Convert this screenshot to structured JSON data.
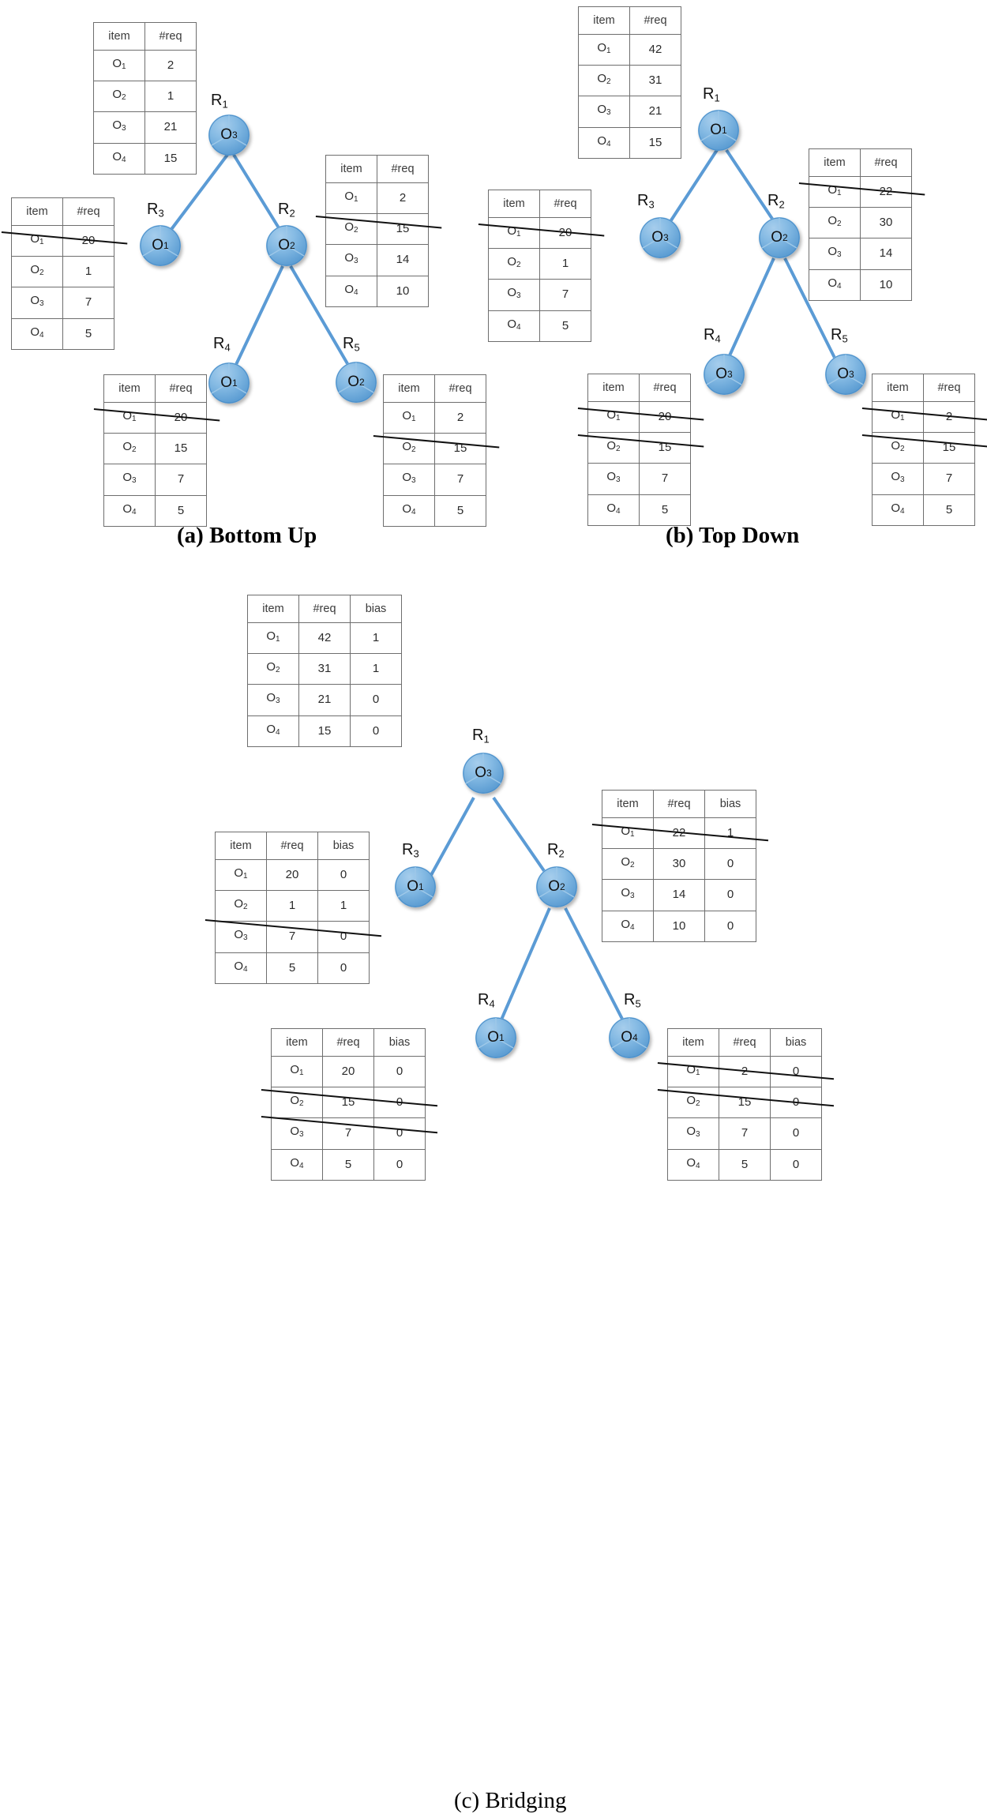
{
  "figure": {
    "panels": [
      {
        "id": "a",
        "caption": "(a) Bottom Up",
        "columns": [
          "item",
          "#req"
        ],
        "nodes": [
          {
            "name": "R1",
            "label": "R",
            "sub": "1",
            "item": "O",
            "item_sub": "3"
          },
          {
            "name": "R3",
            "label": "R",
            "sub": "3",
            "item": "O",
            "item_sub": "1"
          },
          {
            "name": "R2",
            "label": "R",
            "sub": "2",
            "item": "O",
            "item_sub": "2"
          },
          {
            "name": "R4",
            "label": "R",
            "sub": "4",
            "item": "O",
            "item_sub": "1"
          },
          {
            "name": "R5",
            "label": "R",
            "sub": "5",
            "item": "O",
            "item_sub": "2"
          }
        ],
        "tables": [
          {
            "for": "R1",
            "header": [
              "item",
              "#req"
            ],
            "rows": [
              [
                "O1",
                "2"
              ],
              [
                "O2",
                "1"
              ],
              [
                "O3",
                "21"
              ],
              [
                "O4",
                "15"
              ]
            ],
            "struck": []
          },
          {
            "for": "R3",
            "header": [
              "item",
              "#req"
            ],
            "rows": [
              [
                "O1",
                "20"
              ],
              [
                "O2",
                "1"
              ],
              [
                "O3",
                "7"
              ],
              [
                "O4",
                "5"
              ]
            ],
            "struck": [
              0
            ]
          },
          {
            "for": "R2",
            "header": [
              "item",
              "#req"
            ],
            "rows": [
              [
                "O1",
                "2"
              ],
              [
                "O2",
                "15"
              ],
              [
                "O3",
                "14"
              ],
              [
                "O4",
                "10"
              ]
            ],
            "struck": [
              1
            ]
          },
          {
            "for": "R4",
            "header": [
              "item",
              "#req"
            ],
            "rows": [
              [
                "O1",
                "20"
              ],
              [
                "O2",
                "15"
              ],
              [
                "O3",
                "7"
              ],
              [
                "O4",
                "5"
              ]
            ],
            "struck": [
              0
            ]
          },
          {
            "for": "R5",
            "header": [
              "item",
              "#req"
            ],
            "rows": [
              [
                "O1",
                "2"
              ],
              [
                "O2",
                "15"
              ],
              [
                "O3",
                "7"
              ],
              [
                "O4",
                "5"
              ]
            ],
            "struck": [
              1
            ]
          }
        ]
      },
      {
        "id": "b",
        "caption": "(b) Top Down",
        "columns": [
          "item",
          "#req"
        ],
        "nodes": [
          {
            "name": "R1",
            "label": "R",
            "sub": "1",
            "item": "O",
            "item_sub": "1"
          },
          {
            "name": "R3",
            "label": "R",
            "sub": "3",
            "item": "O",
            "item_sub": "3"
          },
          {
            "name": "R2",
            "label": "R",
            "sub": "2",
            "item": "O",
            "item_sub": "2"
          },
          {
            "name": "R4",
            "label": "R",
            "sub": "4",
            "item": "O",
            "item_sub": "3"
          },
          {
            "name": "R5",
            "label": "R",
            "sub": "5",
            "item": "O",
            "item_sub": "3"
          }
        ],
        "tables": [
          {
            "for": "R1",
            "header": [
              "item",
              "#req"
            ],
            "rows": [
              [
                "O1",
                "42"
              ],
              [
                "O2",
                "31"
              ],
              [
                "O3",
                "21"
              ],
              [
                "O4",
                "15"
              ]
            ],
            "struck": []
          },
          {
            "for": "R3",
            "header": [
              "item",
              "#req"
            ],
            "rows": [
              [
                "O1",
                "20"
              ],
              [
                "O2",
                "1"
              ],
              [
                "O3",
                "7"
              ],
              [
                "O4",
                "5"
              ]
            ],
            "struck": [
              0
            ]
          },
          {
            "for": "R2",
            "header": [
              "item",
              "#req"
            ],
            "rows": [
              [
                "O1",
                "22"
              ],
              [
                "O2",
                "30"
              ],
              [
                "O3",
                "14"
              ],
              [
                "O4",
                "10"
              ]
            ],
            "struck": [
              0
            ]
          },
          {
            "for": "R4",
            "header": [
              "item",
              "#req"
            ],
            "rows": [
              [
                "O1",
                "20"
              ],
              [
                "O2",
                "15"
              ],
              [
                "O3",
                "7"
              ],
              [
                "O4",
                "5"
              ]
            ],
            "struck": [
              0,
              1
            ]
          },
          {
            "for": "R5",
            "header": [
              "item",
              "#req"
            ],
            "rows": [
              [
                "O1",
                "2"
              ],
              [
                "O2",
                "15"
              ],
              [
                "O3",
                "7"
              ],
              [
                "O4",
                "5"
              ]
            ],
            "struck": [
              0,
              1
            ]
          }
        ]
      },
      {
        "id": "c",
        "caption": "(c) Bridging",
        "columns": [
          "item",
          "#req",
          "bias"
        ],
        "nodes": [
          {
            "name": "R1",
            "label": "R",
            "sub": "1",
            "item": "O",
            "item_sub": "3"
          },
          {
            "name": "R3",
            "label": "R",
            "sub": "3",
            "item": "O",
            "item_sub": "1"
          },
          {
            "name": "R2",
            "label": "R",
            "sub": "2",
            "item": "O",
            "item_sub": "2"
          },
          {
            "name": "R4",
            "label": "R",
            "sub": "4",
            "item": "O",
            "item_sub": "1"
          },
          {
            "name": "R5",
            "label": "R",
            "sub": "5",
            "item": "O",
            "item_sub": "4"
          }
        ],
        "tables": [
          {
            "for": "R1",
            "header": [
              "item",
              "#req",
              "bias"
            ],
            "rows": [
              [
                "O1",
                "42",
                "1"
              ],
              [
                "O2",
                "31",
                "1"
              ],
              [
                "O3",
                "21",
                "0"
              ],
              [
                "O4",
                "15",
                "0"
              ]
            ],
            "struck": []
          },
          {
            "for": "R3",
            "header": [
              "item",
              "#req",
              "bias"
            ],
            "rows": [
              [
                "O1",
                "20",
                "0"
              ],
              [
                "O2",
                "1",
                "1"
              ],
              [
                "O3",
                "7",
                "0"
              ],
              [
                "O4",
                "5",
                "0"
              ]
            ],
            "struck": [
              2
            ]
          },
          {
            "for": "R2",
            "header": [
              "item",
              "#req",
              "bias"
            ],
            "rows": [
              [
                "O1",
                "22",
                "1"
              ],
              [
                "O2",
                "30",
                "0"
              ],
              [
                "O3",
                "14",
                "0"
              ],
              [
                "O4",
                "10",
                "0"
              ]
            ],
            "struck": [
              0
            ]
          },
          {
            "for": "R4",
            "header": [
              "item",
              "#req",
              "bias"
            ],
            "rows": [
              [
                "O1",
                "20",
                "0"
              ],
              [
                "O2",
                "15",
                "0"
              ],
              [
                "O3",
                "7",
                "0"
              ],
              [
                "O4",
                "5",
                "0"
              ]
            ],
            "struck": [
              1,
              2
            ]
          },
          {
            "for": "R5",
            "header": [
              "item",
              "#req",
              "bias"
            ],
            "rows": [
              [
                "O1",
                "2",
                "0"
              ],
              [
                "O2",
                "15",
                "0"
              ],
              [
                "O3",
                "7",
                "0"
              ],
              [
                "O4",
                "5",
                "0"
              ]
            ],
            "struck": [
              0,
              1
            ]
          }
        ]
      }
    ],
    "colors": {
      "node_fill": "#5f9fd4",
      "edge": "#5b9bd5",
      "table_border": "#6e6e6e",
      "strike": "#111111"
    }
  }
}
